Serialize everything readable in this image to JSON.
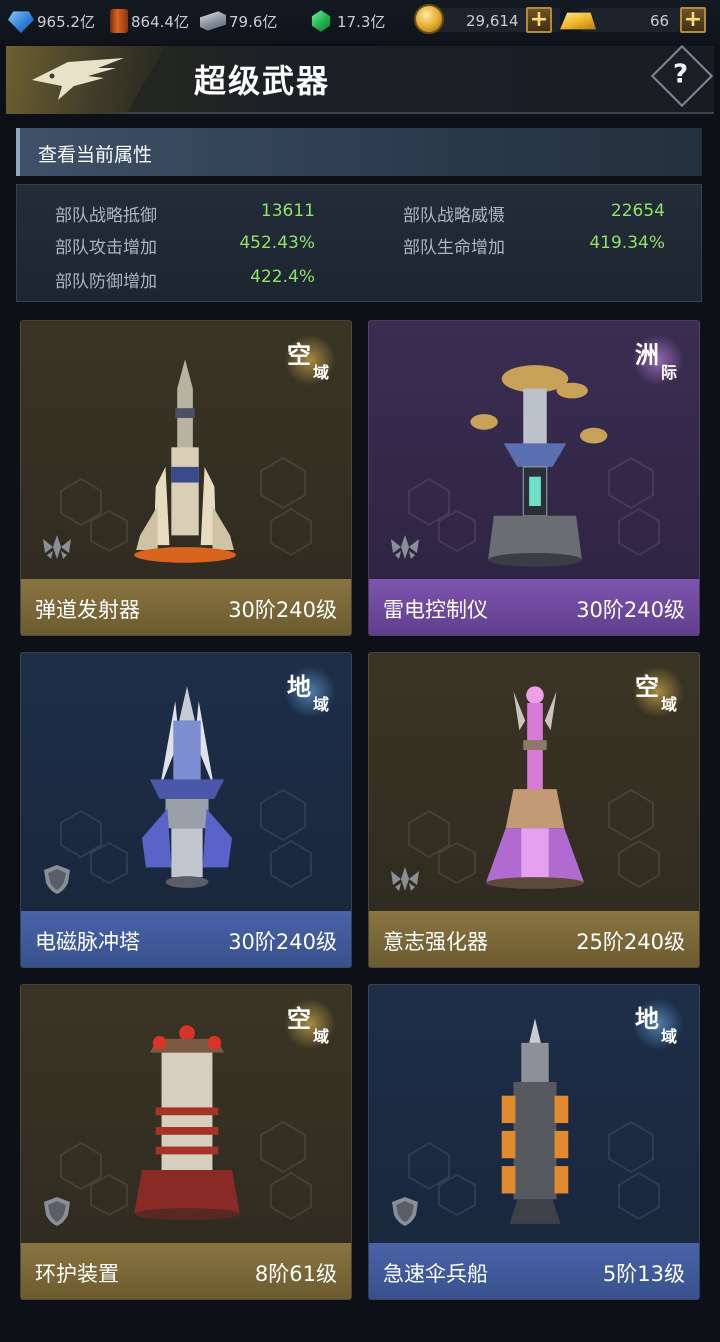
{
  "resources": {
    "crystal": {
      "value": "965.2亿",
      "icon": "crystal-icon"
    },
    "oil": {
      "value": "864.4亿",
      "icon": "oil-barrel-icon"
    },
    "steel": {
      "value": "79.6亿",
      "icon": "steel-ingot-icon"
    },
    "gem": {
      "value": "17.3亿",
      "icon": "green-gem-icon"
    },
    "coin": {
      "value": "29,614",
      "icon": "coin-icon"
    },
    "gold": {
      "value": "66",
      "icon": "gold-bar-icon"
    },
    "plus_label": "+"
  },
  "header": {
    "title": "超级武器",
    "help_label": "?"
  },
  "attributes": {
    "section_title": "查看当前属性",
    "items": [
      {
        "label": "部队战略抵御",
        "value": "13611"
      },
      {
        "label": "部队战略威慑",
        "value": "22654"
      },
      {
        "label": "部队攻击增加",
        "value": "452.43%"
      },
      {
        "label": "部队生命增加",
        "value": "419.34%"
      },
      {
        "label": "部队防御增加",
        "value": "422.4%"
      }
    ],
    "value_color": "#8fe36a"
  },
  "weapons": [
    {
      "name": "弹道发射器",
      "level": "30阶240级",
      "domain_main": "空",
      "domain_sub": "域",
      "theme": "gold",
      "mark": "wings-emblem-icon"
    },
    {
      "name": "雷电控制仪",
      "level": "30阶240级",
      "domain_main": "洲",
      "domain_sub": "际",
      "theme": "purple",
      "mark": "wings-emblem-icon"
    },
    {
      "name": "电磁脉冲塔",
      "level": "30阶240级",
      "domain_main": "地",
      "domain_sub": "域",
      "theme": "blue",
      "mark": "shield-emblem-icon"
    },
    {
      "name": "意志强化器",
      "level": "25阶240级",
      "domain_main": "空",
      "domain_sub": "域",
      "theme": "gold",
      "mark": "wings-emblem-icon"
    },
    {
      "name": "环护装置",
      "level": "8阶61级",
      "domain_main": "空",
      "domain_sub": "域",
      "theme": "gold",
      "mark": "shield-emblem-icon"
    },
    {
      "name": "急速伞兵船",
      "level": "5阶13级",
      "domain_main": "地",
      "domain_sub": "域",
      "theme": "blue",
      "mark": "shield-emblem-icon"
    }
  ]
}
